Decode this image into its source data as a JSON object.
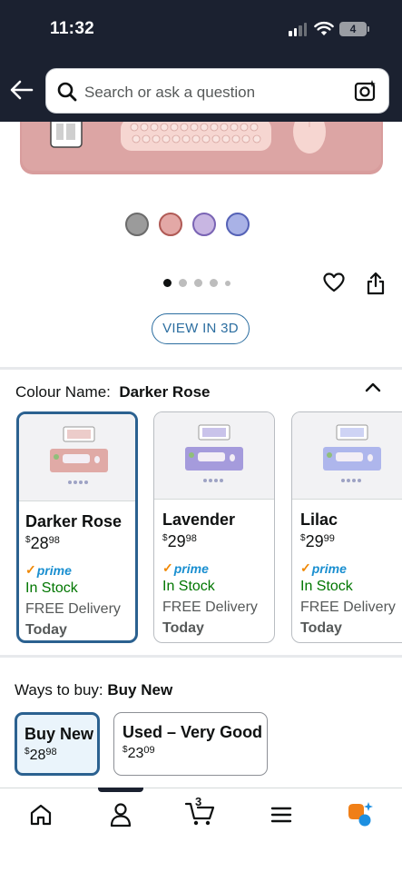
{
  "status_bar": {
    "time": "11:32",
    "battery": "4"
  },
  "search": {
    "placeholder": "Search or ask a question"
  },
  "gallery": {
    "swatch_colors": [
      "#9b9b9b",
      "#e3a8a6",
      "#c8b6e2",
      "#a9b2e6"
    ],
    "dots_total": 5,
    "active_dot": 0
  },
  "view_3d_label": "VIEW IN 3D",
  "colour": {
    "label": "Colour Name:",
    "selected": "Darker Rose"
  },
  "variants": [
    {
      "name": "Darker Rose",
      "price_whole": "28",
      "price_cents": "98",
      "prime": "prime",
      "stock": "In Stock",
      "delivery": "FREE Delivery",
      "when": "Today",
      "mat_color": "#e0aaa6"
    },
    {
      "name": "Lavender",
      "price_whole": "29",
      "price_cents": "98",
      "prime": "prime",
      "stock": "In Stock",
      "delivery": "FREE Delivery",
      "when": "Today",
      "mat_color": "#a59bdc"
    },
    {
      "name": "Lilac",
      "price_whole": "29",
      "price_cents": "99",
      "prime": "prime",
      "stock": "In Stock",
      "delivery": "FREE Delivery",
      "when": "Today",
      "mat_color": "#aeb6ec"
    }
  ],
  "ways": {
    "label": "Ways to buy:",
    "selected": "Buy New"
  },
  "buy_options": [
    {
      "title": "Buy New",
      "price_whole": "28",
      "price_cents": "98"
    },
    {
      "title": "Used – Very Good",
      "price_whole": "23",
      "price_cents": "09"
    }
  ],
  "nav": {
    "cart_count": "3"
  },
  "colors": {
    "accent": "#2b6190",
    "in_stock": "#007600",
    "prime": "#1a8fd0"
  }
}
